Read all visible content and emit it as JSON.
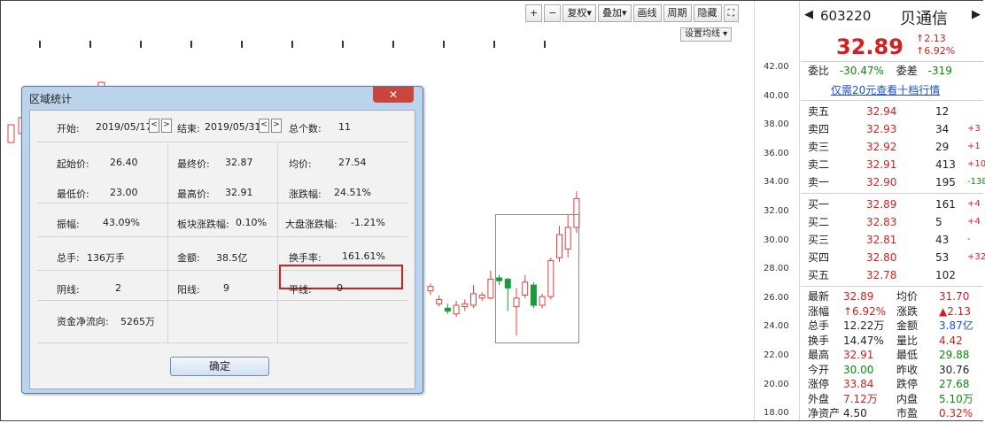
{
  "toolbar": {
    "buttons": [
      {
        "icon": "plus-icon",
        "label": "+"
      },
      {
        "icon": "minus-icon",
        "label": "−"
      },
      {
        "label": "复权▾"
      },
      {
        "label": "叠加▾"
      },
      {
        "label": "画线"
      },
      {
        "label": "周期"
      },
      {
        "label": "隐藏"
      },
      {
        "icon": "expand-icon",
        "label": "⛶"
      }
    ],
    "ma_settings": "设置均线 ▾"
  },
  "y_axis": {
    "ticks": [
      "42.00",
      "40.00",
      "38.00",
      "36.00",
      "34.00",
      "32.00",
      "30.00",
      "28.00",
      "26.00",
      "24.00",
      "22.00",
      "20.00",
      "18.00"
    ]
  },
  "candles": [
    {
      "o": 26.5,
      "c": 26.8,
      "h": 27.0,
      "l": 26.2,
      "up": true
    },
    {
      "o": 25.6,
      "c": 25.9,
      "h": 26.2,
      "l": 25.4,
      "up": true
    },
    {
      "o": 25.3,
      "c": 25.1,
      "h": 25.6,
      "l": 24.9,
      "up": false
    },
    {
      "o": 24.9,
      "c": 25.5,
      "h": 25.8,
      "l": 24.7,
      "up": true
    },
    {
      "o": 25.4,
      "c": 25.6,
      "h": 25.9,
      "l": 25.1,
      "up": true
    },
    {
      "o": 25.5,
      "c": 26.3,
      "h": 26.9,
      "l": 25.3,
      "up": true
    },
    {
      "o": 26.0,
      "c": 26.2,
      "h": 26.4,
      "l": 25.8,
      "up": true
    },
    {
      "o": 26.0,
      "c": 27.3,
      "h": 27.9,
      "l": 25.9,
      "up": true
    },
    {
      "o": 27.4,
      "c": 27.2,
      "h": 27.6,
      "l": 26.9,
      "up": false
    },
    {
      "o": 27.3,
      "c": 26.7,
      "h": 27.4,
      "l": 25.1,
      "up": false
    },
    {
      "o": 25.4,
      "c": 26.0,
      "h": 26.7,
      "l": 23.4,
      "up": true
    },
    {
      "o": 26.2,
      "c": 27.1,
      "h": 27.6,
      "l": 26.0,
      "up": true
    },
    {
      "o": 26.9,
      "c": 25.5,
      "h": 27.1,
      "l": 25.3,
      "up": false
    },
    {
      "o": 25.5,
      "c": 26.1,
      "h": 26.3,
      "l": 25.3,
      "up": true
    },
    {
      "o": 26.1,
      "c": 28.6,
      "h": 28.8,
      "l": 25.9,
      "up": true
    },
    {
      "o": 28.8,
      "c": 30.4,
      "h": 31.0,
      "l": 28.5,
      "up": true
    },
    {
      "o": 29.4,
      "c": 30.9,
      "h": 31.8,
      "l": 28.8,
      "up": true
    },
    {
      "o": 30.9,
      "c": 32.9,
      "h": 33.4,
      "l": 30.5,
      "up": true
    }
  ],
  "dialog": {
    "title": "区域统计",
    "close": "✕",
    "start_label": "开始:",
    "start_value": "2019/05/17",
    "end_label": "结束:",
    "end_value": "2019/05/31",
    "days_label": "总个数:",
    "days_value": "11",
    "open_label": "起始价:",
    "open_value": "26.40",
    "close_label": "最终价:",
    "close_value": "32.87",
    "avg_label": "均价:",
    "avg_value": "27.54",
    "low_label": "最低价:",
    "low_value": "23.00",
    "high_label": "最高价:",
    "high_value": "32.91",
    "chg_label": "涨跌幅:",
    "chg_value": "24.51%",
    "amp_label": "振幅:",
    "amp_value": "43.09%",
    "sector_label": "板块涨跌幅:",
    "sector_value": "0.10%",
    "market_label": "大盘涨跌幅:",
    "market_value": "-1.21%",
    "vol_label": "总手:",
    "vol_value": "136万手",
    "amount_label": "金额:",
    "amount_value": "38.5亿",
    "turnover_label": "换手率:",
    "turnover_value": "161.61%",
    "down_label": "阴线:",
    "down_value": "2",
    "up_label": "阳线:",
    "up_value": "9",
    "flat_label": "平线:",
    "flat_value": "0",
    "flow_label": "资金净流向:",
    "flow_value": "5265万",
    "ok": "确定"
  },
  "stock": {
    "code": "603220",
    "name": "贝通信",
    "price": "32.89",
    "change": "↑2.13",
    "change_pct": "↑6.92%",
    "weibi_label": "委比",
    "weibi_value": "-30.47%",
    "weicha_label": "委差",
    "weicha_value": "-319",
    "promo": "仅需20元查看十档行情",
    "sell": [
      {
        "label": "卖五",
        "price": "32.94",
        "vol": "12",
        "chg": ""
      },
      {
        "label": "卖四",
        "price": "32.93",
        "vol": "34",
        "chg": "+3"
      },
      {
        "label": "卖三",
        "price": "32.92",
        "vol": "29",
        "chg": "+1"
      },
      {
        "label": "卖二",
        "price": "32.91",
        "vol": "413",
        "chg": "+10"
      },
      {
        "label": "卖一",
        "price": "32.90",
        "vol": "195",
        "chg": "-138"
      }
    ],
    "buy": [
      {
        "label": "买一",
        "price": "32.89",
        "vol": "161",
        "chg": "+4"
      },
      {
        "label": "买二",
        "price": "32.83",
        "vol": "5",
        "chg": "+4"
      },
      {
        "label": "买三",
        "price": "32.81",
        "vol": "43",
        "chg": "-"
      },
      {
        "label": "买四",
        "price": "32.80",
        "vol": "53",
        "chg": "+32"
      },
      {
        "label": "买五",
        "price": "32.78",
        "vol": "102",
        "chg": ""
      }
    ],
    "stats": [
      {
        "l1": "最新",
        "v1": "32.89",
        "c1": "red",
        "l2": "均价",
        "v2": "31.70",
        "c2": "red"
      },
      {
        "l1": "涨幅",
        "v1": "↑6.92%",
        "c1": "red",
        "l2": "涨跌",
        "v2": "▲2.13",
        "c2": "red"
      },
      {
        "l1": "总手",
        "v1": "12.22万",
        "c1": "",
        "l2": "金额",
        "v2": "3.87亿",
        "c2": "blue"
      },
      {
        "l1": "换手",
        "v1": "14.47%",
        "c1": "",
        "l2": "量比",
        "v2": "4.42",
        "c2": "red"
      },
      {
        "l1": "最高",
        "v1": "32.91",
        "c1": "red",
        "l2": "最低",
        "v2": "29.88",
        "c2": "green"
      },
      {
        "l1": "今开",
        "v1": "30.00",
        "c1": "green",
        "l2": "昨收",
        "v2": "30.76",
        "c2": ""
      },
      {
        "l1": "涨停",
        "v1": "33.84",
        "c1": "red",
        "l2": "跌停",
        "v2": "27.68",
        "c2": "green"
      },
      {
        "l1": "外盘",
        "v1": "7.12万",
        "c1": "red",
        "l2": "内盘",
        "v2": "5.10万",
        "c2": "green"
      },
      {
        "l1": "净资产",
        "v1": "4.50",
        "c1": "",
        "l2": "市盈",
        "v2": "0.32%",
        "c2": "red"
      }
    ]
  }
}
